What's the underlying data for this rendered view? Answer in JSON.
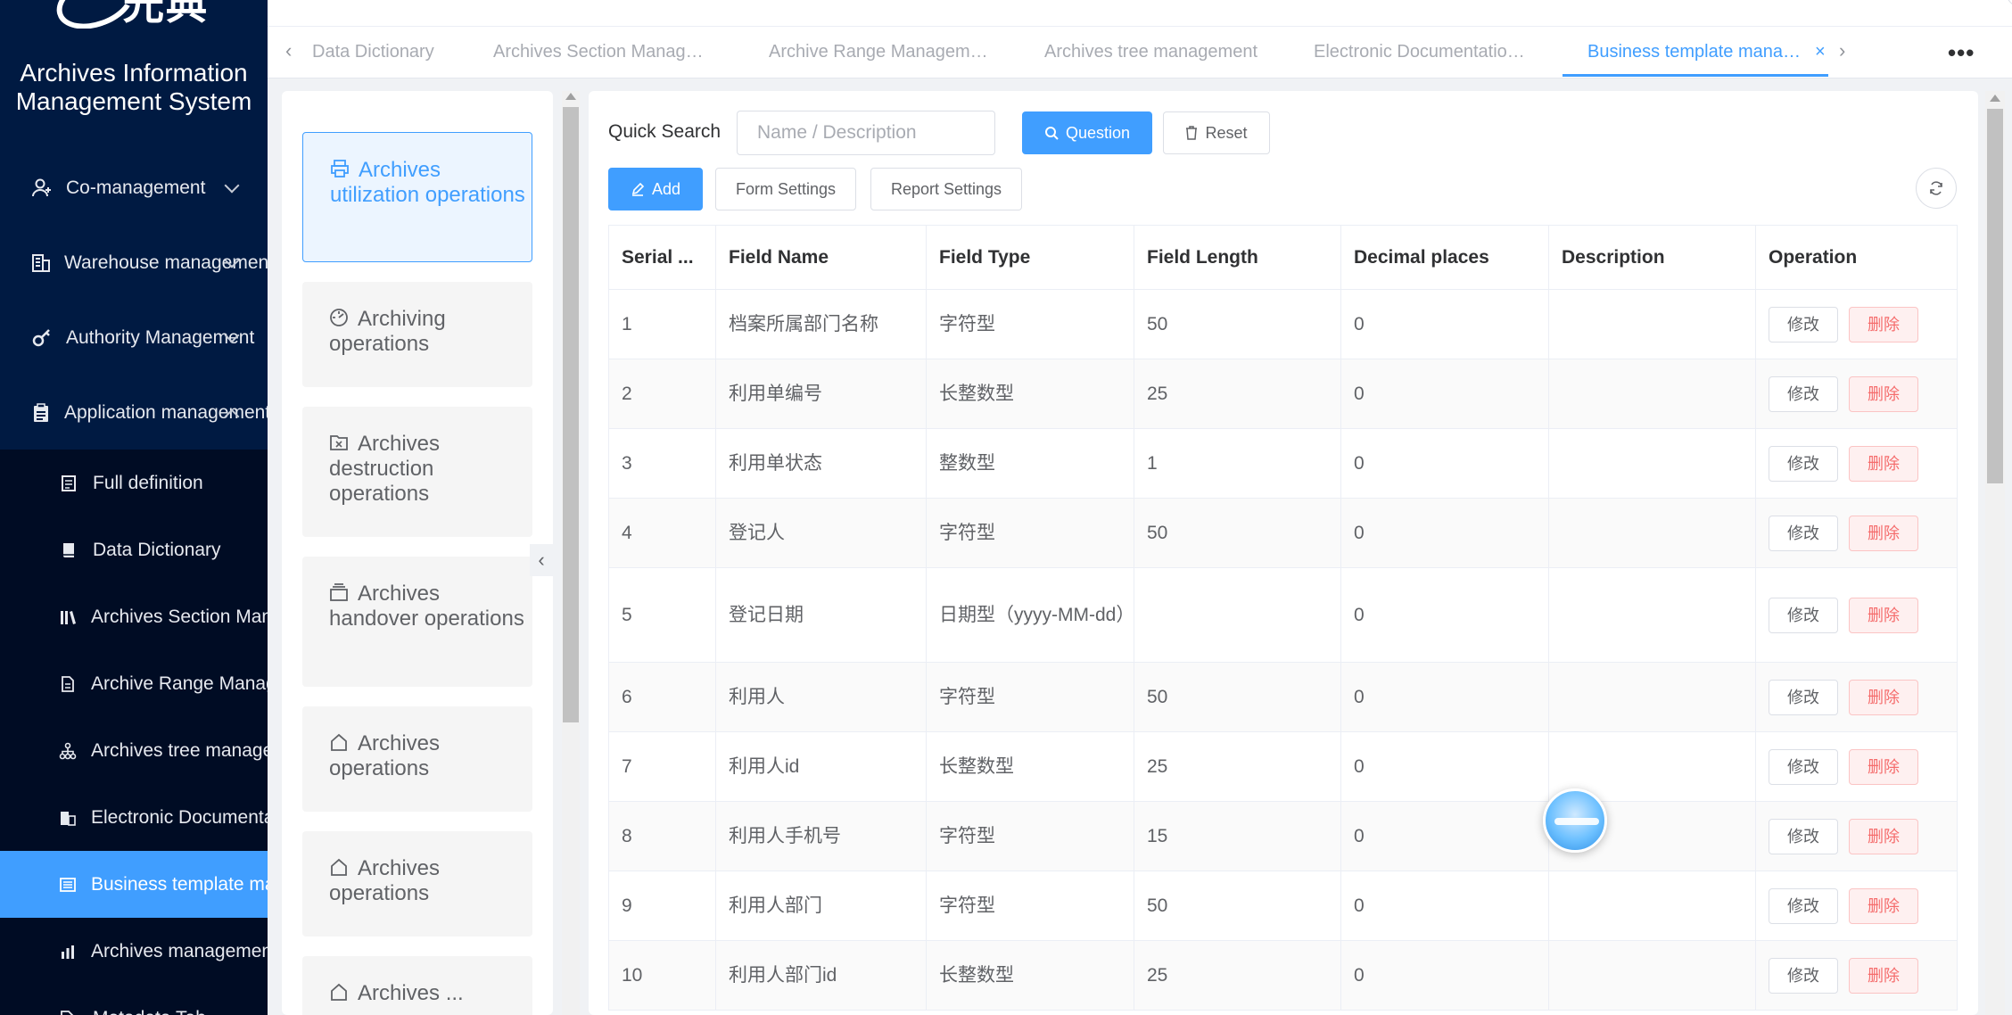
{
  "app": {
    "logo_text": "光典",
    "title": "Archives Information Management System"
  },
  "sidebar": {
    "menus": [
      {
        "label": "Co-management",
        "icon": "user-group-icon"
      },
      {
        "label": "Warehouse management",
        "icon": "building-icon"
      },
      {
        "label": "Authority Management",
        "icon": "key-icon"
      },
      {
        "label": "Application management",
        "icon": "clipboard-icon"
      }
    ],
    "submenus": [
      {
        "label": "Full definition",
        "icon": "document-icon"
      },
      {
        "label": "Data Dictionary",
        "icon": "book-icon"
      },
      {
        "label": "Archives Section Management",
        "icon": "books-icon"
      },
      {
        "label": "Archive Range Management",
        "icon": "file-icon"
      },
      {
        "label": "Archives tree management",
        "icon": "tree-icon"
      },
      {
        "label": "Electronic Documentation",
        "icon": "office-icon"
      },
      {
        "label": "Business template management",
        "icon": "template-icon"
      },
      {
        "label": "Archives management",
        "icon": "chart-icon"
      },
      {
        "label": "Metadata Tab",
        "icon": "tag-icon"
      }
    ],
    "active_submenu_index": 6
  },
  "tabs": {
    "items": [
      "Data Dictionary",
      "Archives Section Manag…",
      "Archive Range Managem…",
      "Archives tree management",
      "Electronic Documentatio…",
      "Business template mana…"
    ],
    "active_index": 5
  },
  "categories": [
    {
      "label": "Archives utilization operations",
      "icon": "printer-icon"
    },
    {
      "label": "Archiving operations",
      "icon": "dashboard-icon"
    },
    {
      "label": "Archives destruction operations",
      "icon": "folder-x-icon"
    },
    {
      "label": "Archives handover operations",
      "icon": "inbox-icon"
    },
    {
      "label": "Archives operations",
      "icon": "home-icon"
    },
    {
      "label": "Archives operations",
      "icon": "home-icon"
    },
    {
      "label": "Archives ...",
      "icon": "home-icon"
    }
  ],
  "toolbar": {
    "quick_search_label": "Quick Search",
    "search_placeholder": "Name  / Description",
    "search_button": "Question",
    "reset_button": "Reset",
    "add_button": "Add",
    "form_settings_button": "Form Settings",
    "report_settings_button": "Report Settings"
  },
  "table": {
    "columns": [
      "Serial ...",
      "Field Name",
      "Field Type",
      "Field Length",
      "Decimal places",
      "Description",
      "Operation"
    ],
    "edit_label": "修改",
    "delete_label": "删除",
    "rows": [
      {
        "serial": "1",
        "name": "档案所属部门名称",
        "type": "字符型",
        "length": "50",
        "decimal": "0",
        "desc": ""
      },
      {
        "serial": "2",
        "name": "利用单编号",
        "type": "长整数型",
        "length": "25",
        "decimal": "0",
        "desc": ""
      },
      {
        "serial": "3",
        "name": "利用单状态",
        "type": "整数型",
        "length": "1",
        "decimal": "0",
        "desc": ""
      },
      {
        "serial": "4",
        "name": "登记人",
        "type": "字符型",
        "length": "50",
        "decimal": "0",
        "desc": ""
      },
      {
        "serial": "5",
        "name": "登记日期",
        "type": "日期型（yyyy-MM-dd）",
        "length": "",
        "decimal": "0",
        "desc": ""
      },
      {
        "serial": "6",
        "name": "利用人",
        "type": "字符型",
        "length": "50",
        "decimal": "0",
        "desc": ""
      },
      {
        "serial": "7",
        "name": "利用人id",
        "type": "长整数型",
        "length": "25",
        "decimal": "0",
        "desc": ""
      },
      {
        "serial": "8",
        "name": "利用人手机号",
        "type": "字符型",
        "length": "15",
        "decimal": "0",
        "desc": ""
      },
      {
        "serial": "9",
        "name": "利用人部门",
        "type": "字符型",
        "length": "50",
        "decimal": "0",
        "desc": ""
      },
      {
        "serial": "10",
        "name": "利用人部门id",
        "type": "长整数型",
        "length": "25",
        "decimal": "0",
        "desc": ""
      }
    ]
  },
  "colors": {
    "primary": "#409eff",
    "sidebar_bg": "#001a42",
    "submenu_bg": "#000c24",
    "danger": "#f56c6c"
  }
}
